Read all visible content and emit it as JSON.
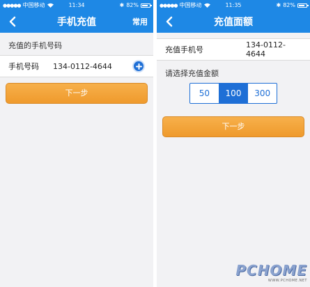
{
  "left": {
    "status": {
      "carrier": "中国移动",
      "time": "11:34",
      "battery": "82%",
      "battery_level": 0.82
    },
    "nav": {
      "title": "手机充值",
      "action": "常用"
    },
    "section_label": "充值的手机号码",
    "phone_label": "手机号码",
    "phone_value": "134-0112-4644",
    "next_button": "下一步"
  },
  "right": {
    "status": {
      "carrier": "中国移动",
      "time": "11:35",
      "battery": "82%",
      "battery_level": 0.82
    },
    "nav": {
      "title": "充值面额"
    },
    "phone_label": "充值手机号",
    "phone_value": "134-0112-4644",
    "amount_label": "请选择充值金额",
    "amounts": [
      "50",
      "100",
      "300"
    ],
    "selected_amount": "100",
    "next_button": "下一步"
  },
  "watermark": {
    "logo": "PCHOME",
    "url": "WWW.PCHOME.NET"
  },
  "colors": {
    "primary": "#1e88e5",
    "accent": "#1e6fd6",
    "button": "#f1a035"
  }
}
